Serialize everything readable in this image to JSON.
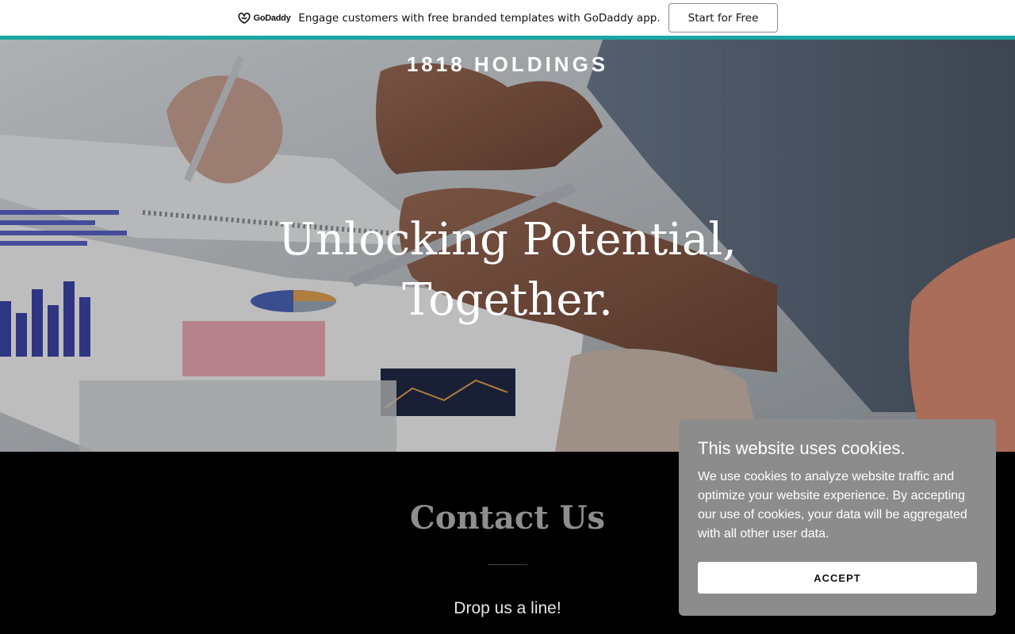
{
  "promo": {
    "logo_text": "GoDaddy",
    "message": "Engage customers with free branded templates with GoDaddy app.",
    "cta_label": "Start for Free",
    "accent_color": "#1ba6a2"
  },
  "hero": {
    "brand": "1818 HOLDINGS",
    "headline_line1": "Unlocking Potential,",
    "headline_line2": "Together."
  },
  "contact": {
    "title": "Contact Us",
    "subtitle": "Drop us a line!"
  },
  "cookie_banner": {
    "title": "This website uses cookies.",
    "body": "We use cookies to analyze website traffic and optimize your website experience. By accepting our use of cookies, your data will be aggregated with all other user data.",
    "accept_label": "ACCEPT"
  }
}
